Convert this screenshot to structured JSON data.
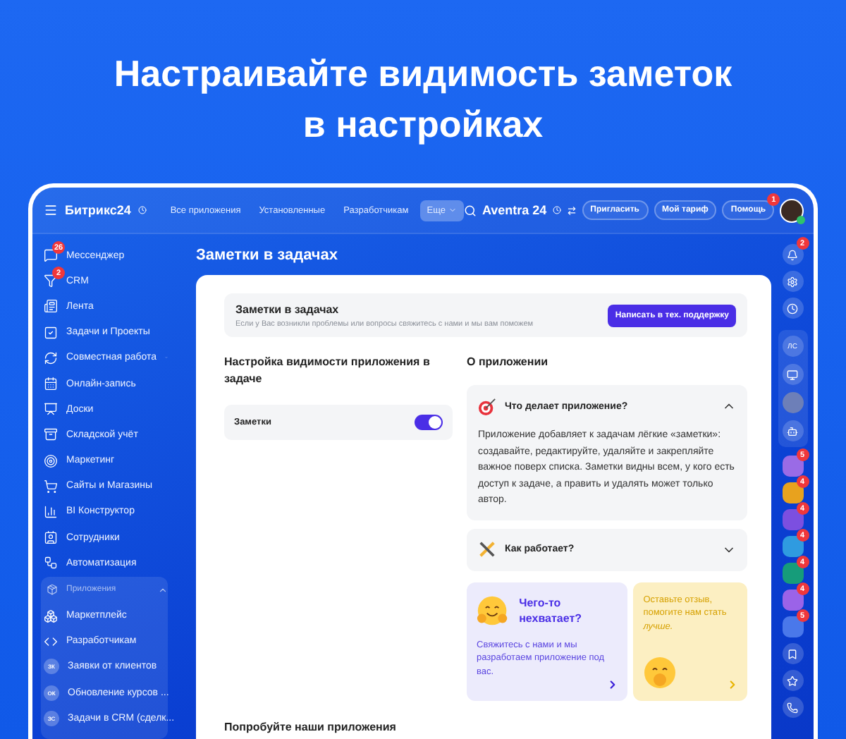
{
  "headline": "Настраивайте видимость заметок в настройках",
  "topbar": {
    "logo": "Битрикс24",
    "tabs": [
      {
        "label": "Все приложения",
        "selected": false
      },
      {
        "label": "Установленные",
        "selected": false
      },
      {
        "label": "Разработчикам",
        "selected": false
      },
      {
        "label": "Еще",
        "selected": true
      }
    ],
    "portal": "Aventra 24",
    "buttons": [
      {
        "label": "Пригласить"
      },
      {
        "label": "Мой тариф"
      },
      {
        "label": "Помощь",
        "badge": "1"
      }
    ]
  },
  "sidebar": {
    "items": [
      {
        "label": "Мессенджер",
        "badge": "26",
        "kind": "item"
      },
      {
        "label": "CRM",
        "badge": "2",
        "kind": "item"
      },
      {
        "label": "Лента",
        "kind": "item"
      },
      {
        "label": "Задачи и Проекты",
        "kind": "item"
      },
      {
        "label": "Совместная работа",
        "kind": "folder"
      },
      {
        "label": "Онлайн-запись",
        "kind": "item"
      },
      {
        "label": "Доски",
        "kind": "item"
      },
      {
        "label": "Складской учёт",
        "kind": "item"
      },
      {
        "label": "Маркетинг",
        "kind": "item"
      },
      {
        "label": "Сайты и Магазины",
        "kind": "item"
      },
      {
        "label": "BI Конструктор",
        "kind": "item"
      },
      {
        "label": "Сотрудники",
        "kind": "item"
      },
      {
        "label": "Автоматизация",
        "kind": "item"
      }
    ],
    "group": {
      "label": "Приложения",
      "expanded": true,
      "items": [
        {
          "label": "Маркетплейс",
          "kind": "item"
        },
        {
          "label": "Разработчикам",
          "kind": "item"
        },
        {
          "label": "Заявки от клиентов",
          "kind": "app",
          "initials": "ЗК"
        },
        {
          "label": "Обновление курсов ...",
          "kind": "app",
          "initials": "ОК"
        },
        {
          "label": "Задачи в CRM (сделк...",
          "kind": "app",
          "initials": "ЗС"
        }
      ]
    }
  },
  "page_title": "Заметки в задачах",
  "support": {
    "title": "Заметки в задачах",
    "text": "Если у Вас возникли проблемы или вопросы свяжитесь с нами и мы вам поможем",
    "button": "Написать в тех. поддержку"
  },
  "settings": {
    "heading": "Настройка видимости приложения в задаче",
    "toggles": [
      {
        "label": "Заметки",
        "on": true
      }
    ]
  },
  "about": {
    "heading": "О приложении",
    "accordion": [
      {
        "title": "Что делает приложение?",
        "expanded": true,
        "text": "Приложение добавляет к задачам лёгкие «заметки»: создавайте, редактируйте, удаляйте и закрепляйте важное поверх списка. Заметки видны всем, у кого есть доступ к задаче, а править и удалять может только автор."
      },
      {
        "title": "Как работает?",
        "expanded": false
      }
    ]
  },
  "promo_cards": [
    {
      "kind": "contact",
      "title": "Чего-то нехватает?",
      "text": "Свяжитесь с нами и мы разработаем приложение под вас."
    },
    {
      "kind": "feedback",
      "text": "Оставьте отзыв, помогите нам стать *лучше.*"
    }
  ],
  "try_apps": {
    "heading": "Попробуйте наши приложения"
  },
  "rail": {
    "top": [
      {
        "kind": "bell",
        "badge": "2"
      },
      {
        "kind": "gear"
      },
      {
        "kind": "clock"
      }
    ],
    "group": [
      {
        "kind": "initials",
        "text": "ЛС"
      },
      {
        "kind": "icon"
      },
      {
        "kind": "avatar"
      },
      {
        "kind": "icon"
      }
    ],
    "apps": [
      {
        "badge": "5",
        "color": "#9a6be6"
      },
      {
        "badge": "4",
        "color": "#e8a21e"
      },
      {
        "badge": "4",
        "color": "#7c4fe0"
      },
      {
        "badge": "4",
        "color": "#2f9be0"
      },
      {
        "badge": "4",
        "color": "#169c7a"
      },
      {
        "badge": "4",
        "color": "#9b63e8"
      },
      {
        "badge": "5",
        "color": "#4a78ea"
      }
    ],
    "bottom": [
      {
        "kind": "bookmark"
      },
      {
        "kind": "star"
      },
      {
        "kind": "phone"
      }
    ]
  }
}
